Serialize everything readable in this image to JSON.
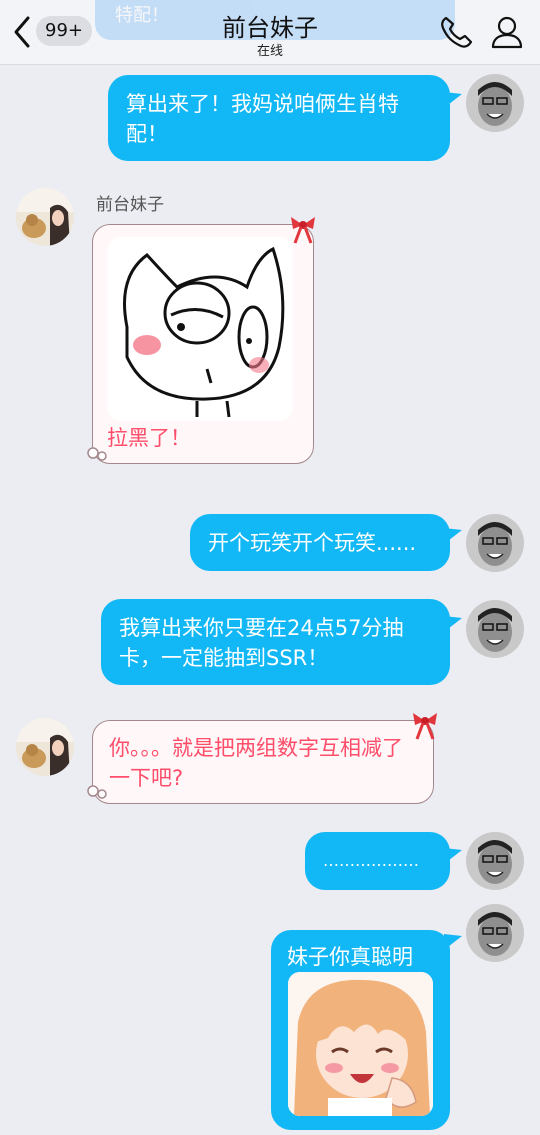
{
  "header": {
    "unread_badge": "99+",
    "title": "前台妹子",
    "status": "在线",
    "ghost_text": "特配！"
  },
  "messages": [
    {
      "from": "me",
      "text": "算出来了！我妈说咱俩生肖特配！"
    },
    {
      "from": "her",
      "sender": "前台妹子",
      "sticker": "cat-sticker",
      "caption": "拉黑了！"
    },
    {
      "from": "me",
      "text": "开个玩笑开个玩笑......"
    },
    {
      "from": "me",
      "text": "我算出来你只要在24点57分抽卡，一定能抽到SSR！"
    },
    {
      "from": "her",
      "text": "你。。。就是把两组数字互相减了一下吧?"
    },
    {
      "from": "me",
      "text": "………………"
    },
    {
      "from": "me",
      "text": "妹子你真聪明",
      "sticker": "anime-girl-sticker"
    }
  ],
  "colors": {
    "my_bubble": "#12b7f5",
    "her_text": "#ff4d6a",
    "background": "#ebedf2"
  }
}
